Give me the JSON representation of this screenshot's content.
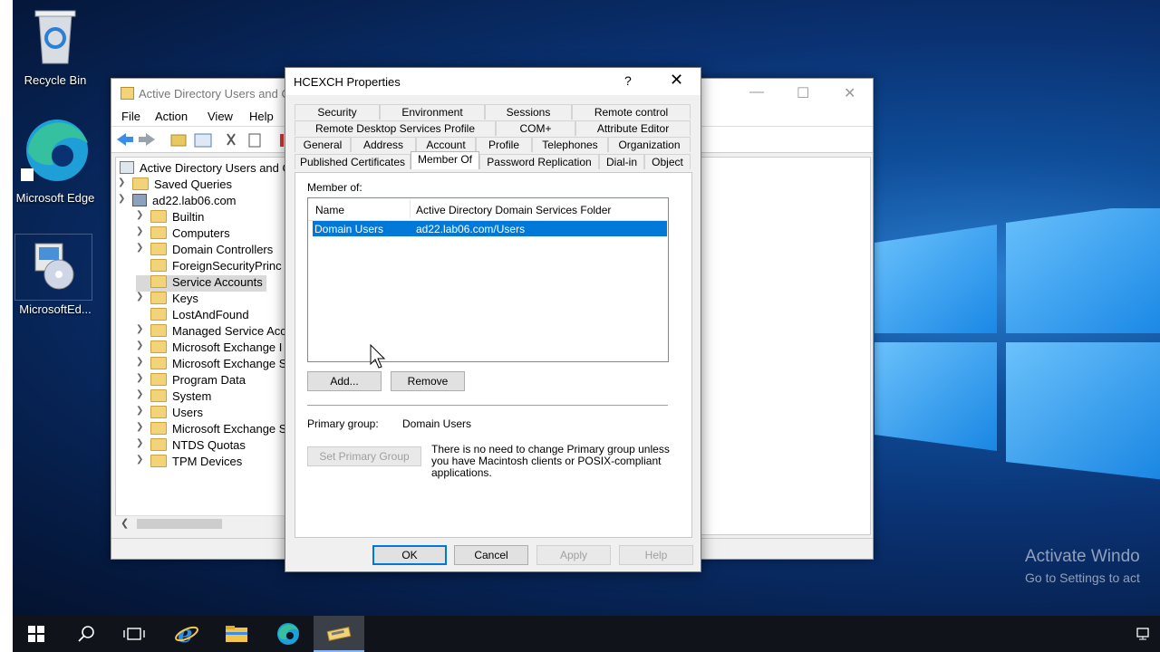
{
  "desktop": {
    "icons": [
      {
        "label": "Recycle Bin",
        "icon": "recycle-bin-icon"
      },
      {
        "label": "Microsoft Edge",
        "icon": "edge-icon"
      },
      {
        "label": "MicrosoftEd...",
        "icon": "installer-icon"
      }
    ],
    "watermark_title": "Activate Windo",
    "watermark_sub": "Go to Settings to act"
  },
  "aduc": {
    "title": "Active Directory Users and C",
    "menu": [
      "File",
      "Action",
      "View",
      "Help"
    ],
    "tree": {
      "root": "Active Directory Users and C",
      "saved_queries": "Saved Queries",
      "domain": "ad22.lab06.com",
      "children": [
        "Builtin",
        "Computers",
        "Domain Controllers",
        "ForeignSecurityPrinc",
        "Service Accounts",
        "Keys",
        "LostAndFound",
        "Managed Service Acc",
        "Microsoft Exchange I",
        "Microsoft Exchange S",
        "Program Data",
        "System",
        "Users",
        "Microsoft Exchange S",
        "NTDS Quotas",
        "TPM Devices"
      ],
      "selected": "Service Accounts"
    }
  },
  "dialog": {
    "title": "HCEXCH Properties",
    "help_glyph": "?",
    "close_glyph": "✕",
    "tabs_row1": [
      "Security",
      "Environment",
      "Sessions",
      "Remote control"
    ],
    "tabs_row2": [
      "Remote Desktop Services Profile",
      "COM+",
      "Attribute Editor"
    ],
    "tabs_row3": [
      "General",
      "Address",
      "Account",
      "Profile",
      "Telephones",
      "Organization"
    ],
    "tabs_row4": [
      "Published Certificates",
      "Member Of",
      "Password Replication",
      "Dial-in",
      "Object"
    ],
    "active_tab": "Member Of",
    "member_of_label": "Member of:",
    "columns": [
      "Name",
      "Active Directory Domain Services Folder"
    ],
    "rows": [
      {
        "name": "Domain Users",
        "folder": "ad22.lab06.com/Users"
      }
    ],
    "add_button": "Add...",
    "remove_button": "Remove",
    "primary_group_label": "Primary group:",
    "primary_group_value": "Domain Users",
    "set_primary_button": "Set Primary Group",
    "note": "There is no need to change Primary group unless you have Macintosh clients or POSIX-compliant applications.",
    "ok": "OK",
    "cancel": "Cancel",
    "apply": "Apply",
    "help": "Help"
  },
  "taskbar": {
    "items": [
      "start-icon",
      "search-icon",
      "task-view-icon",
      "ie-icon",
      "file-explorer-icon",
      "edge-icon",
      "aduc-icon"
    ],
    "active": "aduc-icon"
  },
  "colors": {
    "selection": "#0078d7",
    "taskbar": "#10131a"
  }
}
